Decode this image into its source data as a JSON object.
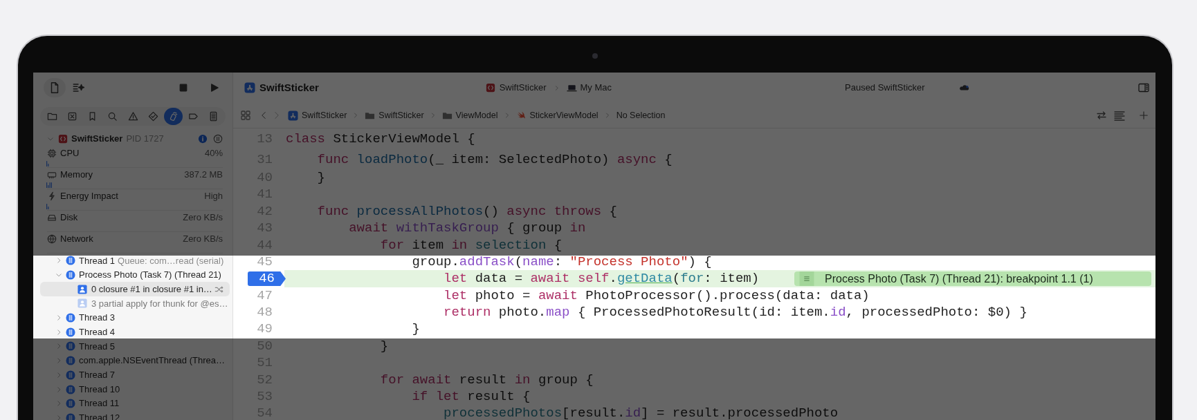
{
  "toolbar": {
    "title": "SwiftSticker",
    "scheme": "SwiftSticker",
    "destination": "My Mac",
    "status": "Paused SwiftSticker"
  },
  "navigator_tabs": [
    {
      "kind": "folder",
      "selected": false
    },
    {
      "kind": "source",
      "selected": false
    },
    {
      "kind": "bookmark",
      "selected": false
    },
    {
      "kind": "search",
      "selected": false
    },
    {
      "kind": "issue",
      "selected": false
    },
    {
      "kind": "test",
      "selected": false
    },
    {
      "kind": "debug",
      "selected": true
    },
    {
      "kind": "breakpoint",
      "selected": false
    },
    {
      "kind": "report",
      "selected": false
    }
  ],
  "process": {
    "name": "SwiftSticker",
    "pid": "PID 1727",
    "expanded": true
  },
  "gauges": [
    {
      "kind": "cpu",
      "label": "CPU",
      "value": "40%",
      "graph": true
    },
    {
      "kind": "memory",
      "label": "Memory",
      "value": "387.2 MB",
      "graph": true
    },
    {
      "kind": "energy",
      "label": "Energy Impact",
      "value": "High",
      "graph": true
    },
    {
      "kind": "disk",
      "label": "Disk",
      "value": "Zero KB/s",
      "graph": false
    },
    {
      "kind": "network",
      "label": "Network",
      "value": "Zero KB/s",
      "graph": false
    }
  ],
  "threads": [
    {
      "label": "Thread 1",
      "detail": "Queue: com…read (serial)",
      "expanded": false
    },
    {
      "label": "Process Photo (Task 7) (Thread 21)",
      "expanded": true,
      "children": [
        {
          "label": "0 closure #1 in closure #1 in…",
          "selected": true
        },
        {
          "label": "3 partial apply for thunk for @es…",
          "selected": false
        }
      ]
    },
    {
      "label": "Thread 3",
      "expanded": false
    },
    {
      "label": "Thread 4",
      "expanded": false
    },
    {
      "label": "Thread 5",
      "expanded": false
    },
    {
      "label": "com.apple.NSEventThread (Threa…",
      "expanded": false
    },
    {
      "label": "Thread 7",
      "expanded": false
    },
    {
      "label": "Thread 10",
      "expanded": false
    },
    {
      "label": "Thread 11",
      "expanded": false
    },
    {
      "label": "Thread 12",
      "expanded": false
    }
  ],
  "breadcrumbs": [
    {
      "kind": "project",
      "label": "SwiftSticker"
    },
    {
      "kind": "folder",
      "label": "SwiftSticker"
    },
    {
      "kind": "folder",
      "label": "ViewModel"
    },
    {
      "kind": "swift",
      "label": "StickerViewModel"
    },
    {
      "kind": "none",
      "label": "No Selection"
    }
  ],
  "code": {
    "lines": [
      {
        "number": "13",
        "breakpoint": false,
        "current": false,
        "tokens": [
          {
            "text": "class",
            "kind": "keyword"
          },
          {
            "text": " StickerViewModel {",
            "kind": "plain"
          }
        ]
      },
      {
        "number": "31",
        "breakpoint": false,
        "current": false,
        "tokens": [
          {
            "text": "    func",
            "kind": "keyword"
          },
          {
            "text": " loadPhoto",
            "kind": "decl"
          },
          {
            "text": "(_ item: SelectedPhoto) ",
            "kind": "plain"
          },
          {
            "text": "async",
            "kind": "keyword"
          },
          {
            "text": " {",
            "kind": "plain"
          }
        ]
      },
      {
        "number": "40",
        "breakpoint": false,
        "current": false,
        "tokens": [
          {
            "text": "    }",
            "kind": "plain"
          }
        ]
      },
      {
        "number": "41",
        "breakpoint": false,
        "current": false
      },
      {
        "number": "42",
        "breakpoint": false,
        "current": false,
        "tokens": [
          {
            "text": "    func",
            "kind": "keyword"
          },
          {
            "text": " processAllPhotos",
            "kind": "decl"
          },
          {
            "text": "() ",
            "kind": "plain"
          },
          {
            "text": "async throws",
            "kind": "keyword"
          },
          {
            "text": " {",
            "kind": "plain"
          }
        ]
      },
      {
        "number": "43",
        "breakpoint": false,
        "current": false,
        "tokens": [
          {
            "text": "        await",
            "kind": "keyword"
          },
          {
            "text": " withTaskGroup",
            "kind": "call"
          },
          {
            "text": " { group ",
            "kind": "plain"
          },
          {
            "text": "in",
            "kind": "keyword"
          }
        ]
      },
      {
        "number": "44",
        "breakpoint": false,
        "current": false,
        "tokens": [
          {
            "text": "            for",
            "kind": "keyword"
          },
          {
            "text": " item ",
            "kind": "plain"
          },
          {
            "text": "in",
            "kind": "keyword"
          },
          {
            "text": " selection",
            "kind": "prop"
          },
          {
            "text": " {",
            "kind": "plain"
          }
        ]
      },
      {
        "number": "45",
        "breakpoint": false,
        "current": false,
        "tokens": [
          {
            "text": "                group.",
            "kind": "plain"
          },
          {
            "text": "addTask",
            "kind": "call"
          },
          {
            "text": "(",
            "kind": "plain"
          },
          {
            "text": "name",
            "kind": "call"
          },
          {
            "text": ": ",
            "kind": "plain"
          },
          {
            "text": "\"Process Photo\"",
            "kind": "string"
          },
          {
            "text": ") {",
            "kind": "plain"
          }
        ]
      },
      {
        "number": "46",
        "breakpoint": true,
        "current": true,
        "annotation": "Process Photo (Task 7) (Thread 21): breakpoint 1.1 (1)",
        "tokens": [
          {
            "text": "                    let",
            "kind": "keyword"
          },
          {
            "text": " data = ",
            "kind": "plain"
          },
          {
            "text": "await self",
            "kind": "keyword"
          },
          {
            "text": ".",
            "kind": "plain"
          },
          {
            "text": "getData",
            "kind": "link"
          },
          {
            "text": "(",
            "kind": "plain"
          },
          {
            "text": "for",
            "kind": "prop"
          },
          {
            "text": ": item)",
            "kind": "plain"
          }
        ]
      },
      {
        "number": "47",
        "breakpoint": false,
        "current": false,
        "tokens": [
          {
            "text": "                    let",
            "kind": "keyword"
          },
          {
            "text": " photo = ",
            "kind": "plain"
          },
          {
            "text": "await",
            "kind": "keyword"
          },
          {
            "text": " PhotoProcessor().process(data: data)",
            "kind": "plain"
          }
        ]
      },
      {
        "number": "48",
        "breakpoint": false,
        "current": false,
        "tokens": [
          {
            "text": "                    return",
            "kind": "keyword"
          },
          {
            "text": " photo.",
            "kind": "plain"
          },
          {
            "text": "map",
            "kind": "call"
          },
          {
            "text": " { ProcessedPhotoResult(id: item.",
            "kind": "plain"
          },
          {
            "text": "id",
            "kind": "call"
          },
          {
            "text": ", processedPhoto: $0) }",
            "kind": "plain"
          }
        ]
      },
      {
        "number": "49",
        "breakpoint": false,
        "current": false,
        "tokens": [
          {
            "text": "                }",
            "kind": "plain"
          }
        ]
      },
      {
        "number": "50",
        "breakpoint": false,
        "current": false,
        "tokens": [
          {
            "text": "            }",
            "kind": "plain"
          }
        ]
      },
      {
        "number": "51",
        "breakpoint": false,
        "current": false
      },
      {
        "number": "52",
        "breakpoint": false,
        "current": false,
        "tokens": [
          {
            "text": "            for await",
            "kind": "keyword"
          },
          {
            "text": " result ",
            "kind": "plain"
          },
          {
            "text": "in",
            "kind": "keyword"
          },
          {
            "text": " group {",
            "kind": "plain"
          }
        ]
      },
      {
        "number": "53",
        "breakpoint": false,
        "current": false,
        "tokens": [
          {
            "text": "                if let",
            "kind": "keyword"
          },
          {
            "text": " result {",
            "kind": "plain"
          }
        ]
      },
      {
        "number": "54",
        "breakpoint": false,
        "current": false,
        "tokens": [
          {
            "text": "                    processedPhotos",
            "kind": "prop"
          },
          {
            "text": "[result.",
            "kind": "plain"
          },
          {
            "text": "id",
            "kind": "call"
          },
          {
            "text": "] = result.processedPhoto",
            "kind": "plain"
          }
        ]
      }
    ]
  }
}
